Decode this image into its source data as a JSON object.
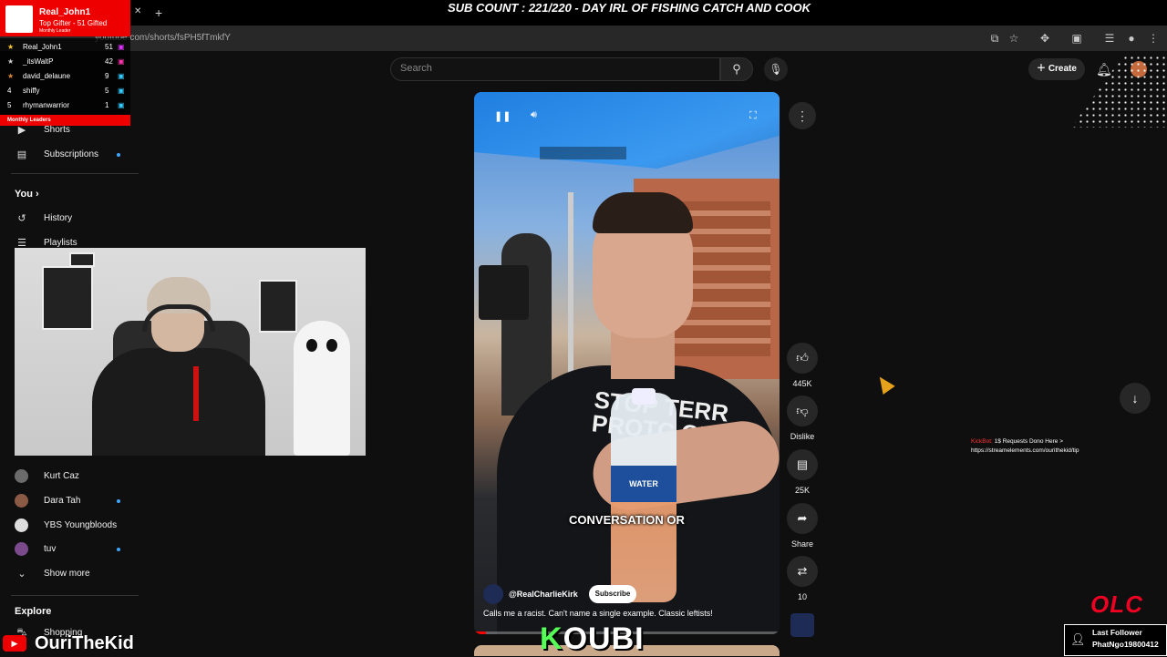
{
  "stream": {
    "title": "SUB COUNT : 221/220 - DAY IRL OF FISHING CATCH AND COOK",
    "top_gifter_name": "Real_John1",
    "top_gifter_sub": "Top Gifter - 51 Gifted",
    "top_gifter_label": "Monthly Leader",
    "leaders": [
      {
        "rank": "★",
        "name": "Real_John1",
        "count": "51"
      },
      {
        "rank": "★",
        "name": "_itsWaltP",
        "count": "42"
      },
      {
        "rank": "★",
        "name": "david_delaune",
        "count": "9"
      },
      {
        "rank": "4",
        "name": "shiffy",
        "count": "5"
      },
      {
        "rank": "5",
        "name": "rhymanwarrior",
        "count": "1"
      }
    ],
    "leaders_footer": "Monthly Leaders",
    "kickbot_name": "KickBot:",
    "kickbot_text": "1$ Requests Dono Here >",
    "kickbot_link": "https://streamelements.com/ourithekid/tip",
    "olc": "OLC",
    "last_follower_title": "Last Follower",
    "last_follower_name": "PhatNgo19800412",
    "streamer_name": "OuriTheKid",
    "kouri": "OUBI",
    "kouri_k": "K"
  },
  "browser": {
    "url": "youtube.com/shorts/fsPH5fTmkfY"
  },
  "header": {
    "search_placeholder": "Search",
    "create_label": "Create"
  },
  "sidebar": {
    "shorts": "Shorts",
    "subscriptions": "Subscriptions",
    "you": "You",
    "history": "History",
    "playlists": "Playlists",
    "channels": [
      {
        "name": "Kurt Caz",
        "color": "#6b6b6b",
        "dot": false
      },
      {
        "name": "Dara Tah",
        "color": "#8a5a44",
        "dot": true
      },
      {
        "name": "YBS Youngbloods",
        "color": "#dddddd",
        "dot": false
      },
      {
        "name": "tuv",
        "color": "#7a4a8c",
        "dot": true
      }
    ],
    "show_more": "Show more",
    "explore": "Explore",
    "shopping": "Shopping"
  },
  "video": {
    "caption": "CONVERSATION OR",
    "shirt_text": "STOP TERR PROTC OUR",
    "bottle_label": "WATER",
    "channel": "@RealCharlieKirk",
    "subscribe": "Subscribe",
    "description": "Calls me a racist. Can't name a single example. Classic leftists!",
    "progress": 0.04
  },
  "actions": {
    "likes": "445K",
    "dislike": "Dislike",
    "comments": "25K",
    "share": "Share",
    "remix": "10"
  },
  "colors": {
    "accent_red": "#ff0000",
    "subscriptions_dot": "#3ea6ff"
  }
}
